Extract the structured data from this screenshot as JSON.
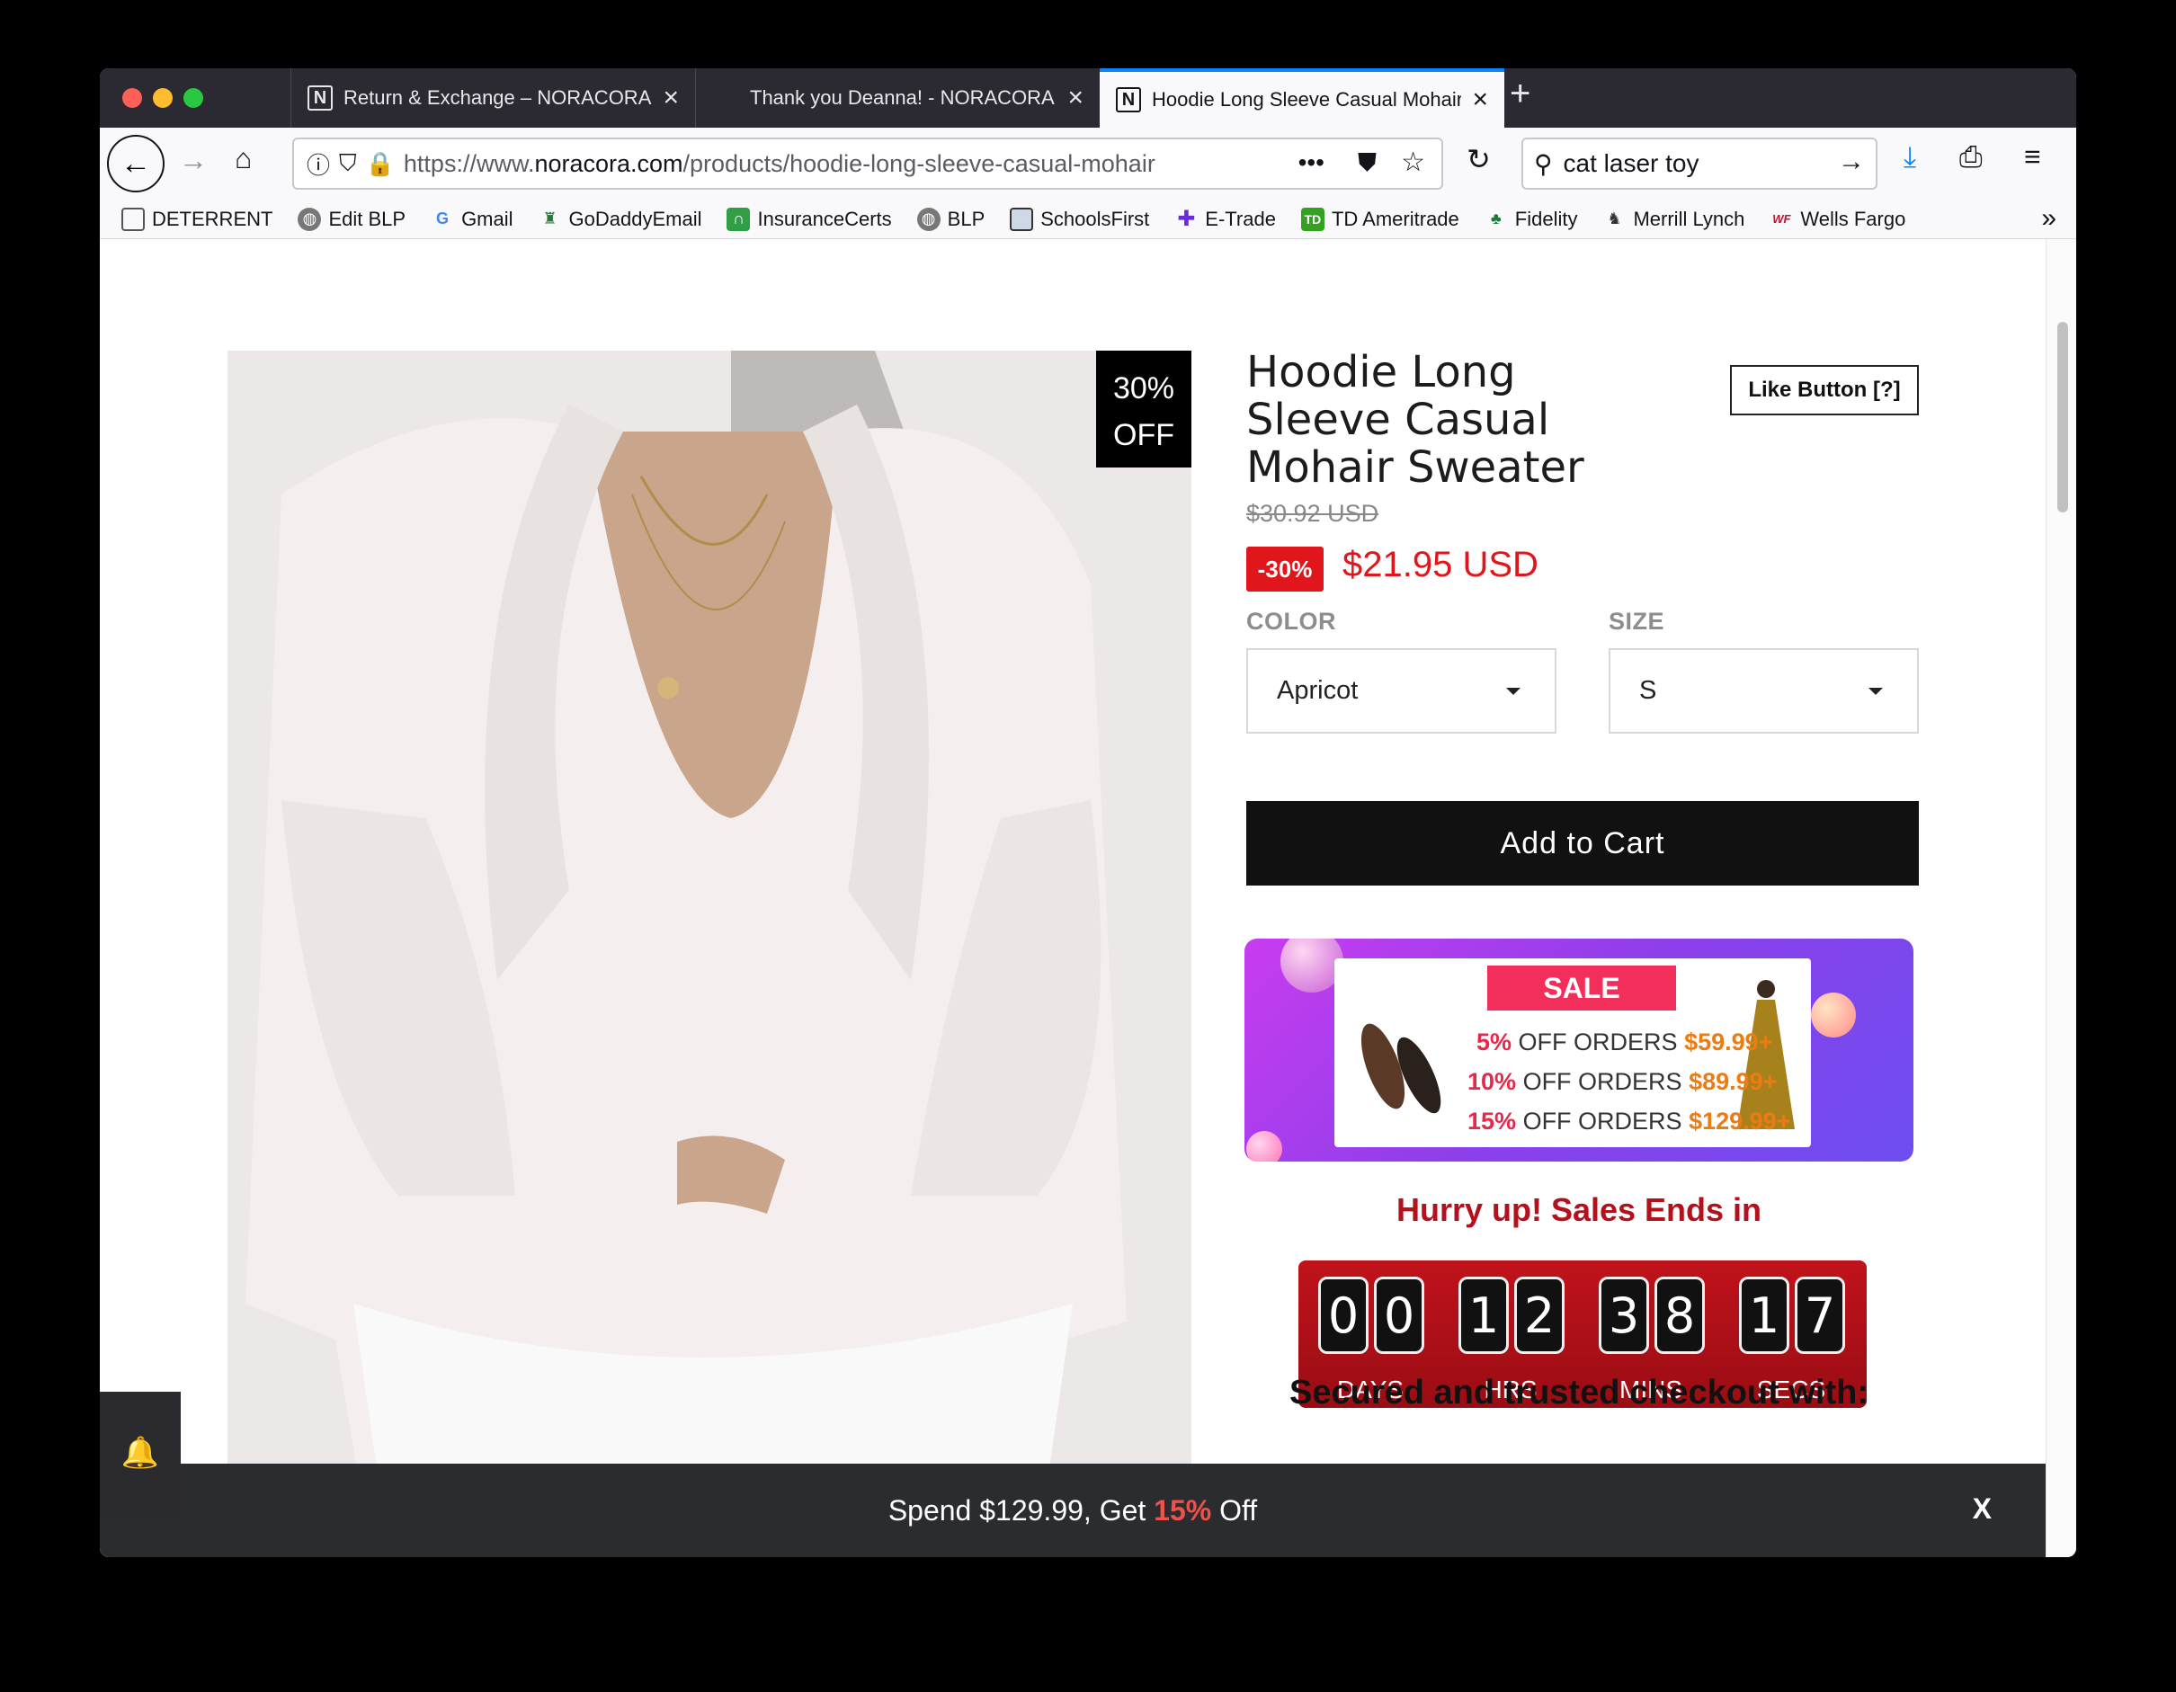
{
  "browser": {
    "tabs": [
      {
        "label": "Return & Exchange – NORACORA",
        "favicon": "N"
      },
      {
        "label": "Thank you Deanna! - NORACORA",
        "favicon": ""
      },
      {
        "label": "Hoodie Long Sleeve Casual Mohair",
        "favicon": "N"
      }
    ],
    "url_prefix": "https://www.",
    "url_domain": "noracora.com",
    "url_path": "/products/hoodie-long-sleeve-casual-mohair",
    "search_value": "cat laser toy",
    "bookmarks": [
      {
        "label": "DETERRENT",
        "icon": "folder-icon"
      },
      {
        "label": "Edit BLP",
        "icon": "globe-icon"
      },
      {
        "label": "Gmail",
        "icon": "google-icon"
      },
      {
        "label": "GoDaddyEmail",
        "icon": "godaddy-icon"
      },
      {
        "label": "InsuranceCerts",
        "icon": "insurance-icon"
      },
      {
        "label": "BLP",
        "icon": "globe-icon"
      },
      {
        "label": "SchoolsFirst",
        "icon": "schoolsfirst-icon"
      },
      {
        "label": "E-Trade",
        "icon": "etrade-icon"
      },
      {
        "label": "TD Ameritrade",
        "icon": "td-icon"
      },
      {
        "label": "Fidelity",
        "icon": "fidelity-icon"
      },
      {
        "label": "Merrill Lynch",
        "icon": "merrill-icon"
      },
      {
        "label": "Wells Fargo",
        "icon": "wellsfargo-icon"
      }
    ]
  },
  "product": {
    "discount_tag_pct": "30%",
    "discount_tag_off": "OFF",
    "title_lines": [
      "Hoodie Long",
      "Sleeve Casual",
      "Mohair Sweater"
    ],
    "like_button": "Like Button [?]",
    "old_price": "$30.92 USD",
    "pct_badge": "-30%",
    "new_price": "$21.95 USD",
    "color_label": "COLOR",
    "color_value": "Apricot",
    "size_label": "SIZE",
    "size_value": "S",
    "add_to_cart": "Add to Cart"
  },
  "sale_banner": {
    "ribbon": "SALE",
    "tiers": [
      {
        "pct": "5%",
        "text": "OFF ORDERS",
        "amount": "$59.99+"
      },
      {
        "pct": "10%",
        "text": "OFF ORDERS",
        "amount": "$89.99+"
      },
      {
        "pct": "15%",
        "text": "OFF ORDERS",
        "amount": "$129.99+"
      }
    ]
  },
  "countdown": {
    "heading": "Hurry up! Sales Ends in",
    "days": [
      "0",
      "0"
    ],
    "hrs": [
      "1",
      "2"
    ],
    "mins": [
      "3",
      "8"
    ],
    "secs": [
      "1",
      "7"
    ],
    "labels": {
      "days": "DAYS",
      "hrs": "HRS",
      "mins": "MINS",
      "secs": "SECS"
    }
  },
  "secured_text": "Secured and trusted checkout with:",
  "bottom_bar": {
    "prefix": "Spend $129.99, Get ",
    "highlight": "15%",
    "suffix": " Off",
    "close": "X"
  },
  "colors": {
    "accent_red": "#e1161c",
    "tab_active_border": "#0a84ff",
    "promo_highlight": "#f0504a"
  }
}
